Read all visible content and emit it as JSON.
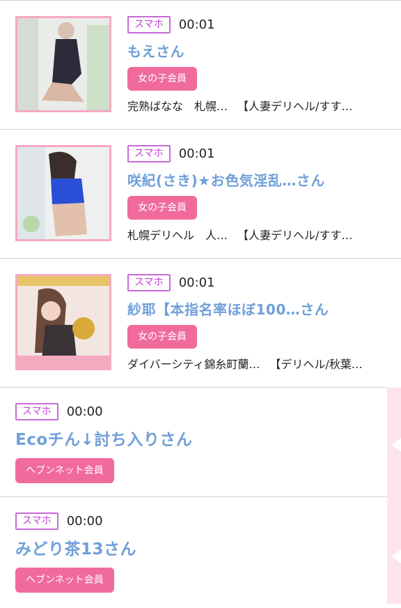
{
  "entries": [
    {
      "device": "スマホ",
      "time": "00:01",
      "name": "もえさん",
      "badge": "女の子会員",
      "shop1": "完熟ばなな　札幌…",
      "shop2": "【人妻デリヘル/すす…"
    },
    {
      "device": "スマホ",
      "time": "00:01",
      "name": "咲紀(さき)★お色気淫乱…さん",
      "badge": "女の子会員",
      "shop1": "札幌デリヘル　人…",
      "shop2": "【人妻デリヘル/すす…"
    },
    {
      "device": "スマホ",
      "time": "00:01",
      "name": "紗耶【本指名率ほぼ100…さん",
      "badge": "女の子会員",
      "shop1": "ダイバーシティ錦糸町蘭…",
      "shop2": "【デリヘル/秋葉…"
    },
    {
      "device": "スマホ",
      "time": "00:00",
      "name": "Ecoチん↓討ち入りさん",
      "badge": "ヘブンネット会員"
    },
    {
      "device": "スマホ",
      "time": "00:00",
      "name": "みどり茶13さん",
      "badge": "ヘブンネット会員"
    }
  ],
  "colors": {
    "accent_pink": "#f06b9c",
    "name_blue": "#6f9fd8",
    "device_purple": "#c041cf",
    "thumb_border": "#f5a9c2"
  }
}
